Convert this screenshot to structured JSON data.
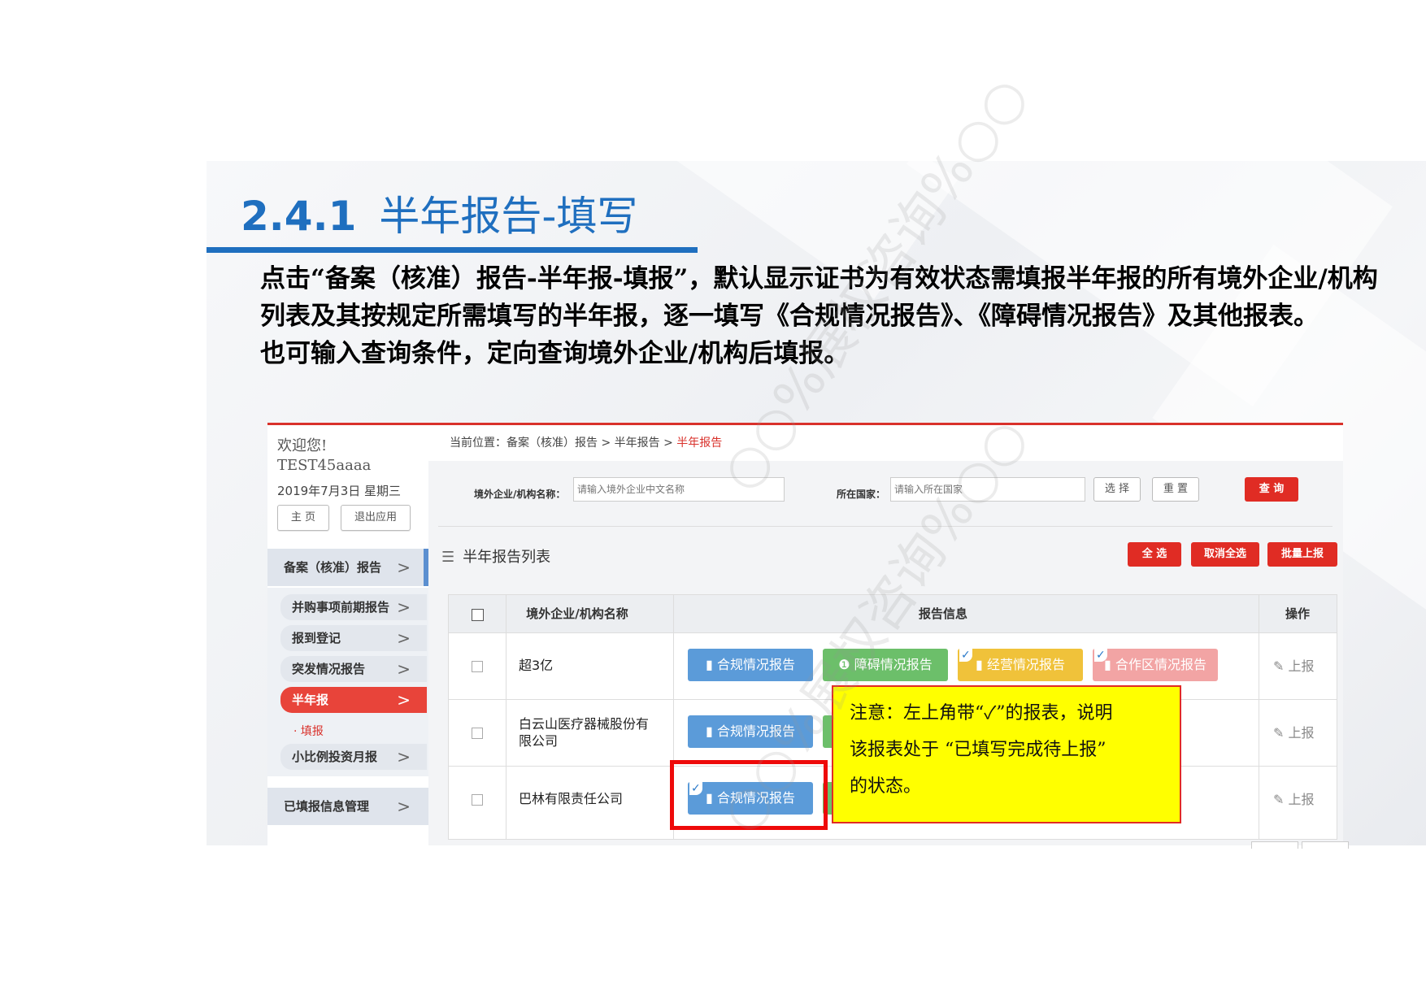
{
  "slide": {
    "title_num": "2.4.1",
    "title_text": "半年报告-填写",
    "paragraph1": "点击“备案（核准）报告-半年报-填报”，默认显示证书为有效状态需填报半年报的所有境外企业/机构列表及其按规定所需填写的半年报，逐一填写《合规情况报告》、《障碍情况报告》及其他报表。",
    "paragraph2": "也可输入查询条件，定向查询境外企业/机构后填报。"
  },
  "watermark": "○○%展权咨询%○○",
  "sidebar": {
    "welcome": "欢迎您!",
    "user": "TEST45aaaa",
    "date": "2019年7月3日 星期三",
    "home_btn": "主 页",
    "exit_btn": "退出应用",
    "main_menu": "备案（核准）报告",
    "sub_items": [
      "并购事项前期报告",
      "报到登记",
      "突发情况报告",
      "半年报",
      "小比例投资月报"
    ],
    "leaf_item": "· 填报",
    "bottom_menu": "已填报信息管理",
    "chevron": ">"
  },
  "breadcrumb": {
    "prefix": "当前位置：",
    "path": "备案（核准）报告 > 半年报告 > ",
    "current": "半年报告"
  },
  "search": {
    "company_label": "境外企业/机构名称：",
    "company_placeholder": "请输入境外企业中文名称",
    "country_label": "所在国家：",
    "country_placeholder": "请输入所在国家",
    "select_btn": "选 择",
    "reset_btn": "重 置",
    "query_btn": "查 询"
  },
  "list": {
    "title": "半年报告列表",
    "select_all": "全 选",
    "cancel_all": "取消全选",
    "batch_submit": "批量上报"
  },
  "table": {
    "headers": [
      "境外企业/机构名称",
      "报告信息",
      "操作"
    ],
    "rows": [
      {
        "name": "超3亿",
        "op": "上报"
      },
      {
        "name": "白云山医疗器械股份有限公司",
        "op": "上报"
      },
      {
        "name": "巴林有限责任公司",
        "op": "上报"
      }
    ],
    "reports": {
      "compliance": "合规情况报告",
      "obstacle": "障碍情况报告",
      "operation": "经营情况报告",
      "cooperation": "合作区情况报告"
    },
    "check_mark": "✓",
    "doc_icon": "▮",
    "info_icon": "❶",
    "edit_icon": "✎"
  },
  "note": {
    "line1": "注意：左上角带“✓”的报表，说明",
    "line2": "该报表处于 “已填写完成待上报”",
    "line3": "的状态。"
  },
  "colors": {
    "title_blue": "#1f6fbf",
    "red": "#e02c24",
    "blue_btn": "#5b9bd9",
    "green_btn": "#6cbf6a",
    "yellow_btn": "#f0c23a",
    "pink_btn": "#f2a4a4",
    "note_bg": "#ffff00"
  }
}
